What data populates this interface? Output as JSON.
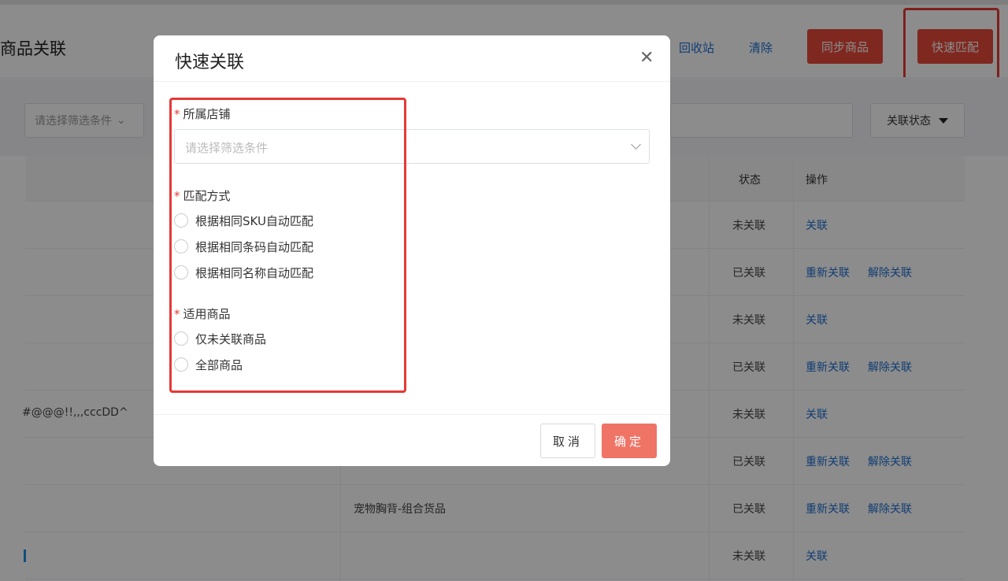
{
  "header": {
    "title": "商品关联",
    "recycle_label": "回收站",
    "clear_label": "清除",
    "sync_label": "同步商品",
    "quick_match_label": "快速匹配"
  },
  "filters": {
    "filter_placeholder": "请选择筛选条件",
    "status_label": "关联状态"
  },
  "table": {
    "columns": [
      "状态",
      "操作"
    ],
    "rows": [
      {
        "extra": "",
        "status": "未关联",
        "actions": [
          "关联"
        ]
      },
      {
        "extra": "",
        "status": "已关联",
        "actions": [
          "重新关联",
          "解除关联"
        ]
      },
      {
        "extra": "",
        "status": "未关联",
        "actions": [
          "关联"
        ]
      },
      {
        "extra": "",
        "status": "已关联",
        "actions": [
          "重新关联",
          "解除关联"
        ]
      },
      {
        "extra": "#@@@!!,,,cccDD^",
        "status": "未关联",
        "actions": [
          "关联"
        ]
      },
      {
        "extra": "",
        "status": "已关联",
        "actions": [
          "重新关联",
          "解除关联"
        ]
      },
      {
        "extra": "宠物胸背-组合货品",
        "status": "已关联",
        "actions": [
          "重新关联",
          "解除关联"
        ]
      },
      {
        "extra": "",
        "status": "未关联",
        "actions": [
          "关联"
        ]
      }
    ]
  },
  "modal": {
    "title": "快速关联",
    "close_icon": "close-icon",
    "store_label": "所属店铺",
    "store_placeholder": "请选择筛选条件",
    "match_label": "匹配方式",
    "match_options": [
      "根据相同SKU自动匹配",
      "根据相同条码自动匹配",
      "根据相同名称自动匹配"
    ],
    "scope_label": "适用商品",
    "scope_options": [
      "仅未关联商品",
      "全部商品"
    ],
    "cancel_label": "取消",
    "ok_label": "确定"
  },
  "colors": {
    "primary_btn": "#e84a3b",
    "link": "#1f6fd1",
    "highlight_outline": "#e53935"
  }
}
